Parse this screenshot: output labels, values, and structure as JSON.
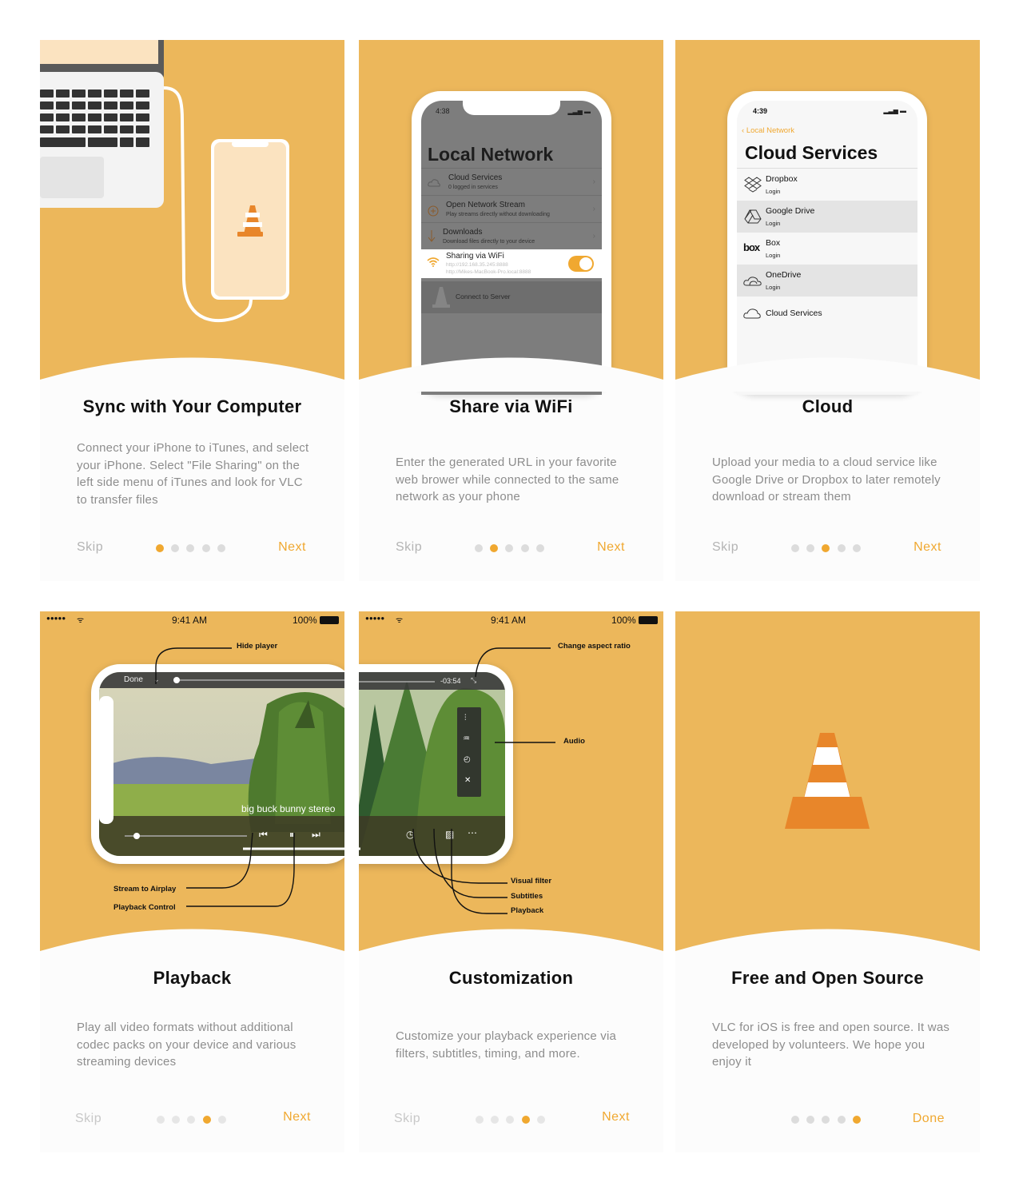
{
  "colors": {
    "accent": "#f0a830",
    "hero": "#ecb75b",
    "title": "#111111",
    "text": "#8d8d8d",
    "muted": "#b4b4b4"
  },
  "cards": [
    {
      "title": "Sync with Your Computer",
      "description": "Connect your iPhone to iTunes, and select your iPhone. Select \"File Sharing\" on the left side menu of iTunes and look for VLC to transfer files",
      "skip": "Skip",
      "next": "Next",
      "page": 1,
      "pages": 5
    },
    {
      "title": "Share via WiFi",
      "description": "Enter the generated URL in your favorite web brower while connected to the same network as your phone",
      "skip": "Skip",
      "next": "Next",
      "page": 2,
      "pages": 5,
      "phone": {
        "time": "4:38",
        "heading": "Local Network",
        "items": [
          {
            "title": "Cloud Services",
            "subtitle": "0 logged in services"
          },
          {
            "title": "Open Network Stream",
            "subtitle": "Play streams directly without downloading"
          },
          {
            "title": "Downloads",
            "subtitle": "Download files directly to your device"
          }
        ],
        "wifi": {
          "title": "Sharing via WiFi",
          "url1": "http://192.168.35.245:8888",
          "url2": "http://Mikes-MacBook-Pro.local:8888",
          "enabled": true
        },
        "connect": "Connect to Server"
      }
    },
    {
      "title": "Cloud",
      "description": "Upload your media to a cloud service like Google Drive or Dropbox to later remotely download or stream them",
      "skip": "Skip",
      "next": "Next",
      "page": 3,
      "pages": 5,
      "phone": {
        "time": "4:39",
        "back": "Local Network",
        "heading": "Cloud Services",
        "services": [
          {
            "name": "Dropbox",
            "action": "Login"
          },
          {
            "name": "Google Drive",
            "action": "Login"
          },
          {
            "name": "Box",
            "action": "Login"
          },
          {
            "name": "OneDrive",
            "action": "Login"
          }
        ],
        "footer": "Cloud Services",
        "box_logo": "box"
      }
    },
    {
      "title": "Playback",
      "description": "Play all video formats without additional codec packs on your device and various streaming devices",
      "skip": "Skip",
      "next": "Next",
      "page": 4,
      "pages": 5,
      "status": {
        "carrier": "●●●●● ",
        "time": "9:41 AM",
        "battery": "100%"
      },
      "player": {
        "done": "Done",
        "subtitle": "big buck bunny stereo"
      },
      "annotations": {
        "hide_player": "Hide player",
        "airplay": "Stream to Airplay",
        "control": "Playback Control"
      }
    },
    {
      "title": "Customization",
      "description": "Customize your playback experience via filters, subtitles, timing, and more.",
      "skip": "Skip",
      "next": "Next",
      "page": 4,
      "pages": 5,
      "status": {
        "carrier": "●●●●● ",
        "time": "9:41 AM",
        "battery": "100%"
      },
      "player": {
        "remaining": "-03:54"
      },
      "annotations": {
        "aspect": "Change aspect ratio",
        "audio": "Audio",
        "filter": "Visual filter",
        "subtitles": "Subtitles",
        "playback": "Playback"
      }
    },
    {
      "title": "Free and Open Source",
      "description": "VLC for iOS is free and open source. It was developed by volunteers. We hope you enjoy it",
      "done": "Done",
      "page": 5,
      "pages": 5
    }
  ]
}
